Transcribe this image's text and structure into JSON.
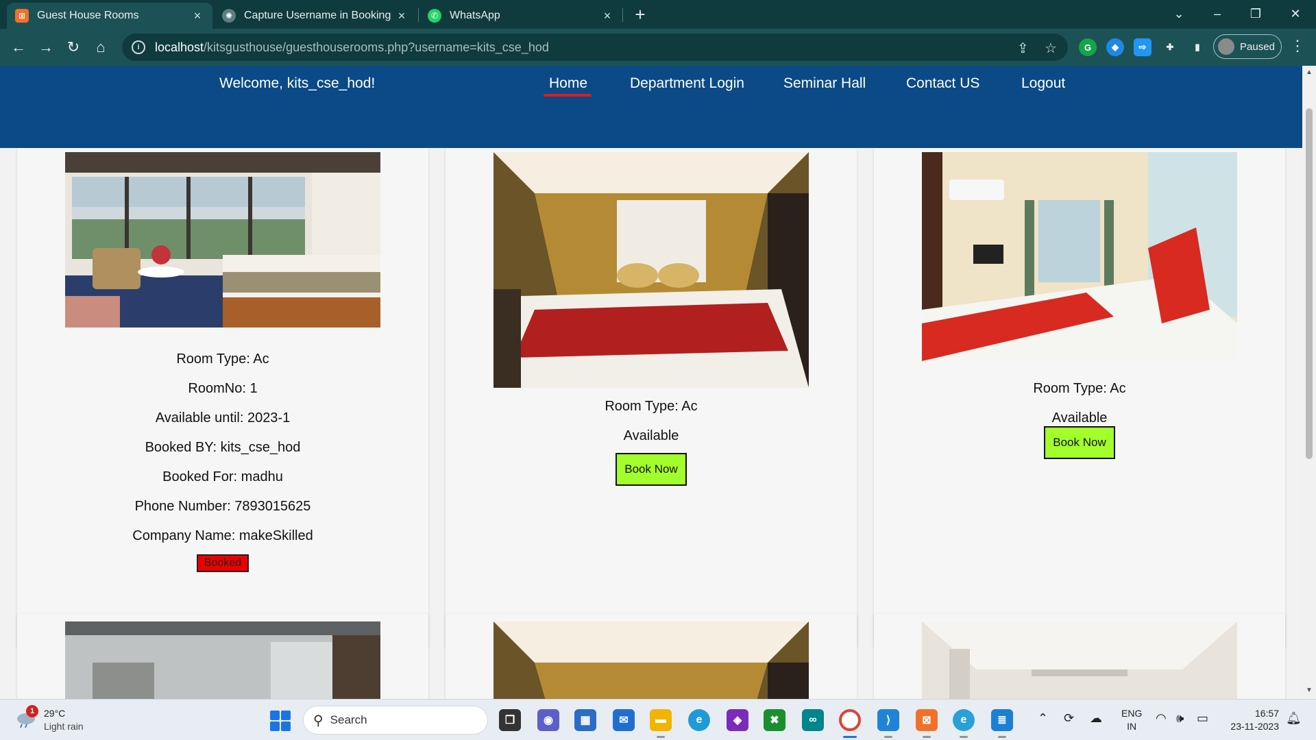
{
  "browser": {
    "tabs": [
      {
        "title": "Guest House Rooms",
        "active": true,
        "favicon": "xampp-icon"
      },
      {
        "title": "Capture Username in Booking",
        "active": false,
        "favicon": "chatgpt-icon"
      },
      {
        "title": "WhatsApp",
        "active": false,
        "favicon": "whatsapp-icon"
      }
    ],
    "url_host": "localhost",
    "url_path": "/kitsgusthouse/guesthouserooms.php?username=kits_cse_hod",
    "profile_label": "Paused"
  },
  "site": {
    "welcome": "Welcome, kits_cse_hod!",
    "nav": [
      "Home",
      "Department Login",
      "Seminar Hall",
      "Contact US",
      "Logout"
    ],
    "active_nav": "Home"
  },
  "rooms": [
    {
      "room_type": "Room Type: Ac",
      "room_no": "RoomNo: 1",
      "available_until": "Available until: 2023-1",
      "booked_by": "Booked BY: kits_cse_hod",
      "booked_for": "Booked For: madhu",
      "phone": "Phone Number: 7893015625",
      "company": "Company Name: makeSkilled",
      "status": "Booked"
    },
    {
      "room_type": "Room Type: Ac",
      "status_text": "Available",
      "button": "Book Now"
    },
    {
      "room_type": "Room Type: Ac",
      "status_text": "Available",
      "button": "Book Now"
    }
  ],
  "colors": {
    "header_bg": "#0b4a86",
    "active_underline": "#e21b1b",
    "book_button": "#a3ff2b",
    "booked_badge": "#ee0000"
  },
  "taskbar": {
    "weather_temp": "29°C",
    "weather_desc": "Light rain",
    "weather_badge": "1",
    "search_placeholder": "Search",
    "lang_line1": "ENG",
    "lang_line2": "IN",
    "time": "16:57",
    "date": "23-11-2023"
  }
}
